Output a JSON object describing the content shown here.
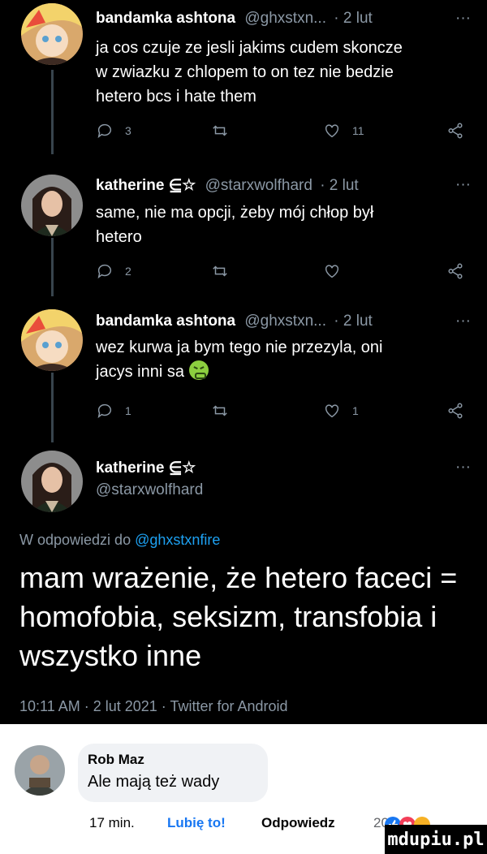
{
  "tweets": [
    {
      "name": "bandamka ashtona",
      "handle": "@ghxstxn...",
      "time": "· 2 lut",
      "more": "···",
      "lines": [
        "ja cos czuje ze jesli jakims cudem skoncze",
        "w zwiazku z chlopem to on tez nie bedzie",
        "hetero bcs i hate them"
      ],
      "replies": "3",
      "retweets": "",
      "likes": "11"
    },
    {
      "name": "katherine ⋸☆",
      "handle": "@starxwolfhard",
      "time": "· 2 lut",
      "more": "···",
      "lines": [
        "same, nie ma opcji, żeby mój chłop był",
        "hetero"
      ],
      "replies": "2",
      "retweets": "",
      "likes": ""
    },
    {
      "name": "bandamka ashtona",
      "handle": "@ghxstxn...",
      "time": "· 2 lut",
      "more": "···",
      "lines": [
        "wez kurwa ja bym tego nie przezyla, oni",
        "jacys inni sa"
      ],
      "replies": "1",
      "retweets": "",
      "likes": "1"
    }
  ],
  "main_tweet": {
    "name": "katherine ⋸☆",
    "handle": "@starxwolfhard",
    "more": "···",
    "reply_prefix": "W odpowiedzi do",
    "reply_mention": "@ghxstxnfire",
    "text": "mam wrażenie, że hetero faceci = homofobia, seksizm, transfobia i wszystko inne",
    "meta": "10:11 AM · 2 lut 2021 · Twitter for Android"
  },
  "facebook_comment": {
    "author": "Rob Maz",
    "text": "Ale mają też wady",
    "time": "17 min.",
    "like_label": "Lubię to!",
    "reply_label": "Odpowiedz",
    "reaction_count": "20"
  },
  "watermark": "mdupiu.pl",
  "colors": {
    "background": "#000000",
    "secondary_text": "#8b98a5",
    "twitter_blue": "#1da1f2",
    "facebook_blue": "#1877f2"
  }
}
